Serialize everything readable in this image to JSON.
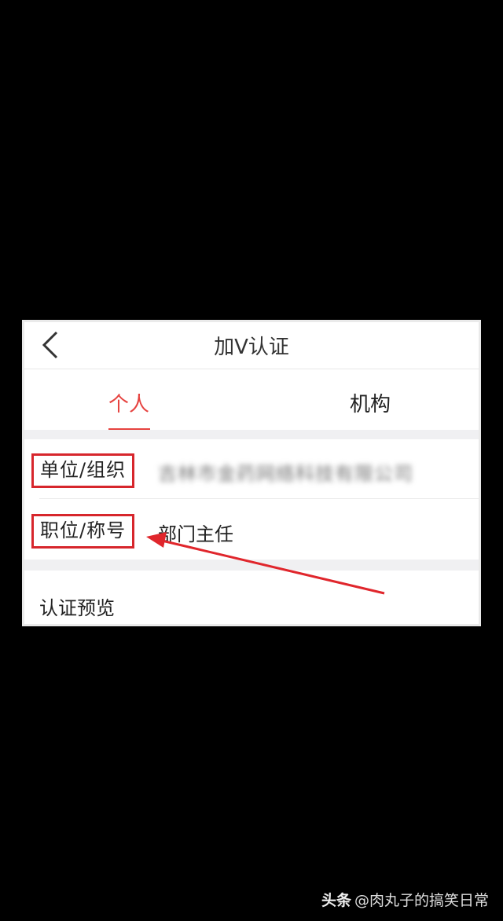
{
  "header": {
    "title": "加V认证",
    "back_icon": "chevron-left-icon"
  },
  "tabs": [
    {
      "label": "个人",
      "active": true
    },
    {
      "label": "机构",
      "active": false
    }
  ],
  "fields": [
    {
      "label": "单位/组织",
      "value": "吉林市金药网络科技有限公司",
      "blurred": true
    },
    {
      "label": "职位/称号",
      "value": "部门主任",
      "blurred": false
    }
  ],
  "preview": {
    "label": "认证预览"
  },
  "watermark": {
    "brand": "头条",
    "handle": "@肉丸子的搞笑日常"
  },
  "colors": {
    "accent": "#e64340",
    "highlight_box": "#d7262c",
    "arrow": "#e0262c",
    "background": "#000000"
  }
}
